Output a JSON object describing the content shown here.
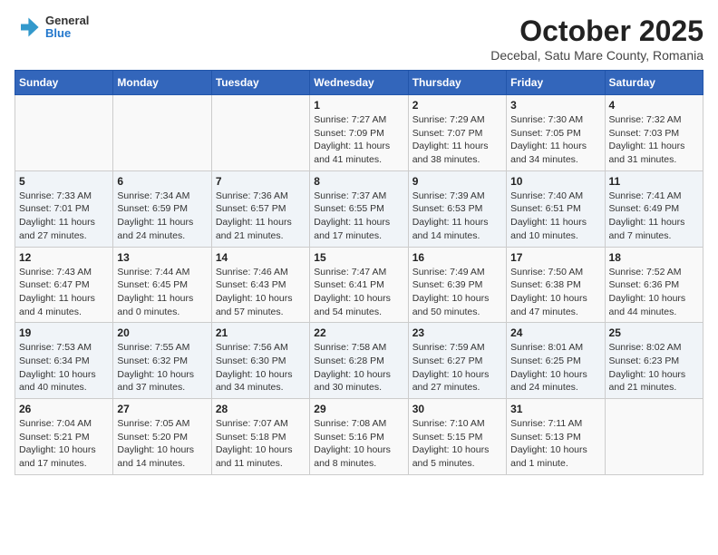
{
  "header": {
    "logo": {
      "general": "General",
      "blue": "Blue"
    },
    "month_year": "October 2025",
    "subtitle": "Decebal, Satu Mare County, Romania"
  },
  "weekdays": [
    "Sunday",
    "Monday",
    "Tuesday",
    "Wednesday",
    "Thursday",
    "Friday",
    "Saturday"
  ],
  "weeks": [
    [
      {
        "day": "",
        "info": ""
      },
      {
        "day": "",
        "info": ""
      },
      {
        "day": "",
        "info": ""
      },
      {
        "day": "1",
        "info": "Sunrise: 7:27 AM\nSunset: 7:09 PM\nDaylight: 11 hours and 41 minutes."
      },
      {
        "day": "2",
        "info": "Sunrise: 7:29 AM\nSunset: 7:07 PM\nDaylight: 11 hours and 38 minutes."
      },
      {
        "day": "3",
        "info": "Sunrise: 7:30 AM\nSunset: 7:05 PM\nDaylight: 11 hours and 34 minutes."
      },
      {
        "day": "4",
        "info": "Sunrise: 7:32 AM\nSunset: 7:03 PM\nDaylight: 11 hours and 31 minutes."
      }
    ],
    [
      {
        "day": "5",
        "info": "Sunrise: 7:33 AM\nSunset: 7:01 PM\nDaylight: 11 hours and 27 minutes."
      },
      {
        "day": "6",
        "info": "Sunrise: 7:34 AM\nSunset: 6:59 PM\nDaylight: 11 hours and 24 minutes."
      },
      {
        "day": "7",
        "info": "Sunrise: 7:36 AM\nSunset: 6:57 PM\nDaylight: 11 hours and 21 minutes."
      },
      {
        "day": "8",
        "info": "Sunrise: 7:37 AM\nSunset: 6:55 PM\nDaylight: 11 hours and 17 minutes."
      },
      {
        "day": "9",
        "info": "Sunrise: 7:39 AM\nSunset: 6:53 PM\nDaylight: 11 hours and 14 minutes."
      },
      {
        "day": "10",
        "info": "Sunrise: 7:40 AM\nSunset: 6:51 PM\nDaylight: 11 hours and 10 minutes."
      },
      {
        "day": "11",
        "info": "Sunrise: 7:41 AM\nSunset: 6:49 PM\nDaylight: 11 hours and 7 minutes."
      }
    ],
    [
      {
        "day": "12",
        "info": "Sunrise: 7:43 AM\nSunset: 6:47 PM\nDaylight: 11 hours and 4 minutes."
      },
      {
        "day": "13",
        "info": "Sunrise: 7:44 AM\nSunset: 6:45 PM\nDaylight: 11 hours and 0 minutes."
      },
      {
        "day": "14",
        "info": "Sunrise: 7:46 AM\nSunset: 6:43 PM\nDaylight: 10 hours and 57 minutes."
      },
      {
        "day": "15",
        "info": "Sunrise: 7:47 AM\nSunset: 6:41 PM\nDaylight: 10 hours and 54 minutes."
      },
      {
        "day": "16",
        "info": "Sunrise: 7:49 AM\nSunset: 6:39 PM\nDaylight: 10 hours and 50 minutes."
      },
      {
        "day": "17",
        "info": "Sunrise: 7:50 AM\nSunset: 6:38 PM\nDaylight: 10 hours and 47 minutes."
      },
      {
        "day": "18",
        "info": "Sunrise: 7:52 AM\nSunset: 6:36 PM\nDaylight: 10 hours and 44 minutes."
      }
    ],
    [
      {
        "day": "19",
        "info": "Sunrise: 7:53 AM\nSunset: 6:34 PM\nDaylight: 10 hours and 40 minutes."
      },
      {
        "day": "20",
        "info": "Sunrise: 7:55 AM\nSunset: 6:32 PM\nDaylight: 10 hours and 37 minutes."
      },
      {
        "day": "21",
        "info": "Sunrise: 7:56 AM\nSunset: 6:30 PM\nDaylight: 10 hours and 34 minutes."
      },
      {
        "day": "22",
        "info": "Sunrise: 7:58 AM\nSunset: 6:28 PM\nDaylight: 10 hours and 30 minutes."
      },
      {
        "day": "23",
        "info": "Sunrise: 7:59 AM\nSunset: 6:27 PM\nDaylight: 10 hours and 27 minutes."
      },
      {
        "day": "24",
        "info": "Sunrise: 8:01 AM\nSunset: 6:25 PM\nDaylight: 10 hours and 24 minutes."
      },
      {
        "day": "25",
        "info": "Sunrise: 8:02 AM\nSunset: 6:23 PM\nDaylight: 10 hours and 21 minutes."
      }
    ],
    [
      {
        "day": "26",
        "info": "Sunrise: 7:04 AM\nSunset: 5:21 PM\nDaylight: 10 hours and 17 minutes."
      },
      {
        "day": "27",
        "info": "Sunrise: 7:05 AM\nSunset: 5:20 PM\nDaylight: 10 hours and 14 minutes."
      },
      {
        "day": "28",
        "info": "Sunrise: 7:07 AM\nSunset: 5:18 PM\nDaylight: 10 hours and 11 minutes."
      },
      {
        "day": "29",
        "info": "Sunrise: 7:08 AM\nSunset: 5:16 PM\nDaylight: 10 hours and 8 minutes."
      },
      {
        "day": "30",
        "info": "Sunrise: 7:10 AM\nSunset: 5:15 PM\nDaylight: 10 hours and 5 minutes."
      },
      {
        "day": "31",
        "info": "Sunrise: 7:11 AM\nSunset: 5:13 PM\nDaylight: 10 hours and 1 minute."
      },
      {
        "day": "",
        "info": ""
      }
    ]
  ]
}
